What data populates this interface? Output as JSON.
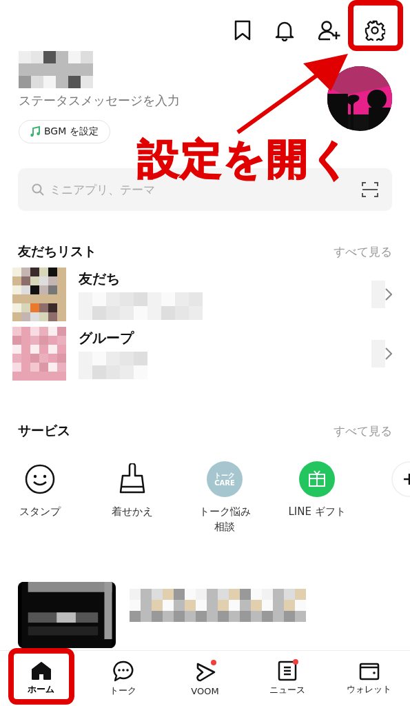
{
  "profile": {
    "status_placeholder": "ステータスメッセージを入力",
    "bgm_button": "BGM を設定"
  },
  "search": {
    "placeholder": "ミニアプリ、テーマ"
  },
  "friends_section": {
    "title": "友だちリスト",
    "see_all": "すべて見る",
    "items": [
      {
        "name": "友だち",
        "kind": "friends"
      },
      {
        "name": "グループ",
        "kind": "groups"
      }
    ]
  },
  "services_section": {
    "title": "サービス",
    "see_all": "すべて見る",
    "items": [
      {
        "kind": "sticker",
        "label": [
          "スタンプ"
        ]
      },
      {
        "kind": "theme",
        "label": [
          "着せかえ"
        ]
      },
      {
        "kind": "talkcare",
        "label": [
          "トーク悩み",
          "相談"
        ],
        "icon_text": [
          "トーク",
          "CARE"
        ]
      },
      {
        "kind": "gift",
        "label": [
          "LINE ギフト"
        ]
      },
      {
        "kind": "add"
      }
    ]
  },
  "bottom_nav": [
    {
      "kind": "home",
      "label": "ホーム",
      "selected": true,
      "badge": false
    },
    {
      "kind": "talk",
      "label": "トーク",
      "selected": false,
      "badge": false
    },
    {
      "kind": "voom",
      "label": "VOOM",
      "selected": false,
      "badge": true
    },
    {
      "kind": "news",
      "label": "ニュース",
      "selected": false,
      "badge": true
    },
    {
      "kind": "wallet",
      "label": "ウォレット",
      "selected": false,
      "badge": false
    }
  ],
  "annotation": {
    "label": "設定を開く"
  }
}
